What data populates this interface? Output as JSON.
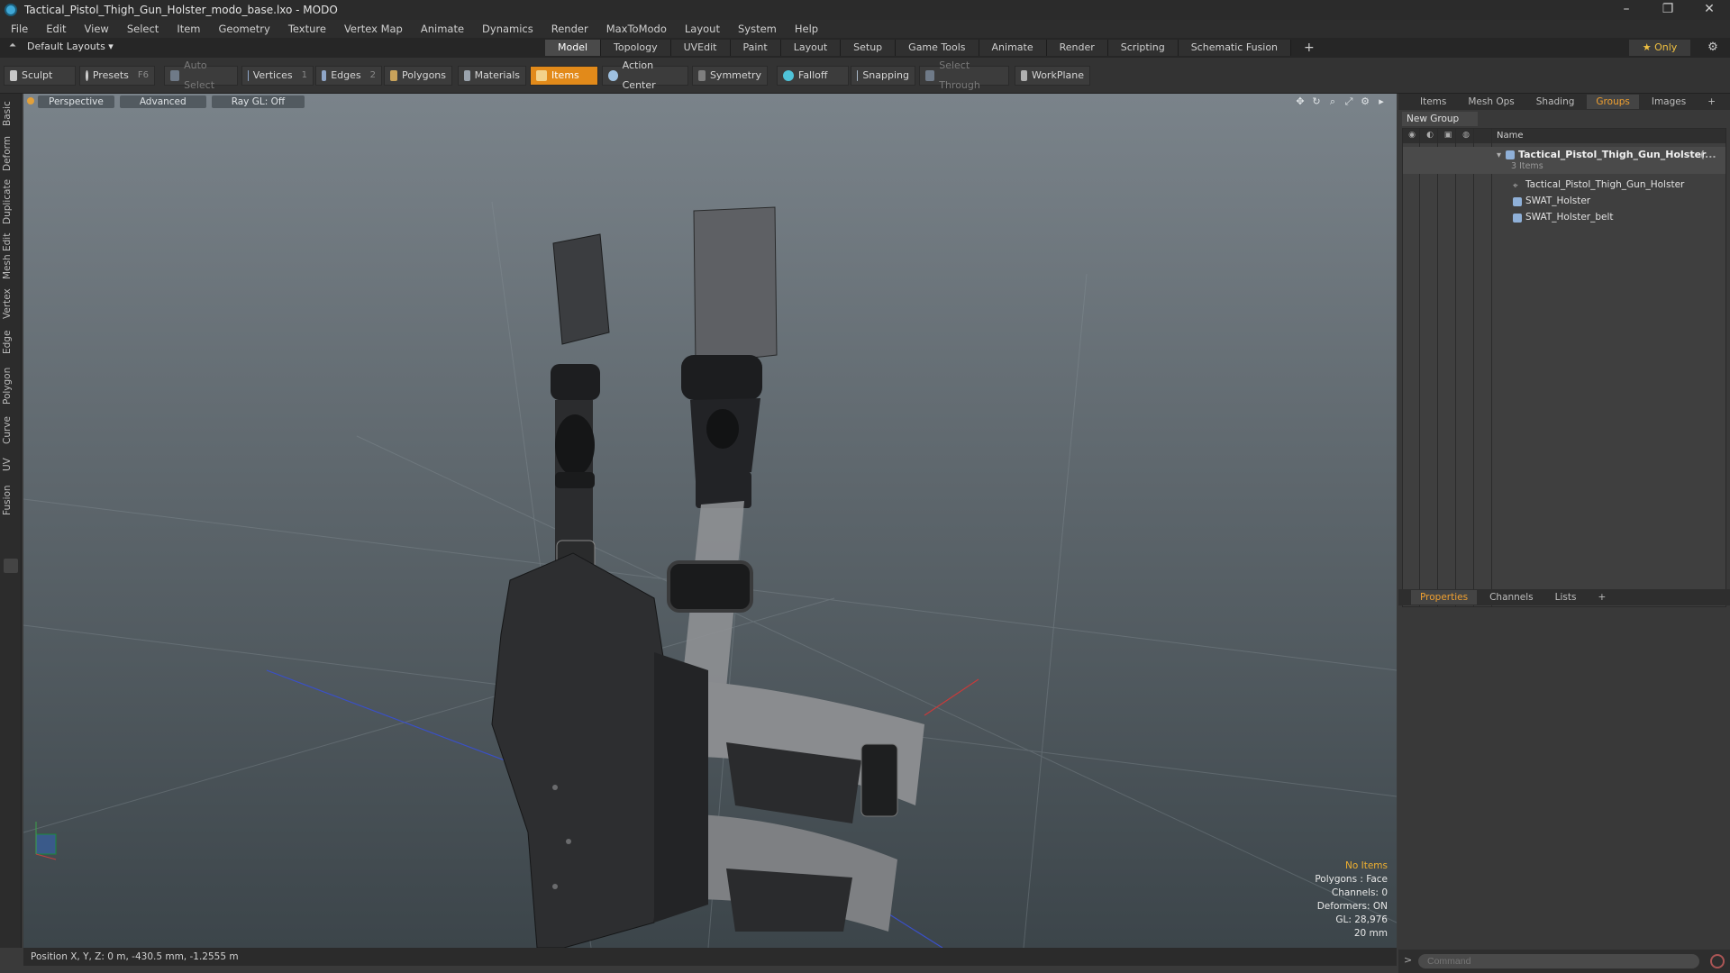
{
  "window": {
    "title": "Tactical_Pistol_Thigh_Gun_Holster_modo_base.lxo - MODO",
    "controls": [
      "–",
      "❐",
      "✕"
    ]
  },
  "menu": [
    "File",
    "Edit",
    "View",
    "Select",
    "Item",
    "Geometry",
    "Texture",
    "Vertex Map",
    "Animate",
    "Dynamics",
    "Render",
    "MaxToModo",
    "Layout",
    "System",
    "Help"
  ],
  "layout": {
    "current": "Default Layouts ▾",
    "tabs": [
      "Model",
      "Topology",
      "UVEdit",
      "Paint",
      "Layout",
      "Setup",
      "Game Tools",
      "Animate",
      "Render",
      "Scripting",
      "Schematic Fusion",
      "+"
    ],
    "active_tab": "Model",
    "only_label": "★  Only"
  },
  "toolbar": {
    "sculpt": "Sculpt",
    "presets": "Presets",
    "presets_key": "F6",
    "auto_select": "Auto Select",
    "vertices": "Vertices",
    "vertices_count": "1",
    "edges": "Edges",
    "edges_count": "2",
    "polygons": "Polygons",
    "materials": "Materials",
    "items": "Items",
    "action_center": "Action Center",
    "symmetry": "Symmetry",
    "falloff": "Falloff",
    "snapping": "Snapping",
    "select_through": "Select Through",
    "workplane": "WorkPlane"
  },
  "left_tabs": [
    "Basic",
    "Deform",
    "Duplicate",
    "Mesh Edit",
    "Vertex",
    "Edge",
    "Polygon",
    "Curve",
    "UV",
    "Fusion"
  ],
  "viewport": {
    "view_mode": "Perspective",
    "shading": "Advanced",
    "raygl": "Ray GL: Off",
    "hud": {
      "selection": "No Items",
      "polygons": "Polygons : Face",
      "channels": "Channels: 0",
      "deformers": "Deformers: ON",
      "gl": "GL: 28,976",
      "unit": "20 mm"
    }
  },
  "status": {
    "position": "Position X, Y, Z:  0 m, -430.5 mm, -1.2555 m"
  },
  "right_panel": {
    "tabs": [
      "Items",
      "Mesh Ops",
      "Shading",
      "Groups",
      "Images",
      "+"
    ],
    "active_tab": "Groups",
    "new_group": "New Group",
    "name_header": "Name",
    "group": {
      "name": "Tactical_Pistol_Thigh_Gun_Holster",
      "suffix": "(...",
      "count": "3 Items",
      "children": [
        "Tactical_Pistol_Thigh_Gun_Holster",
        "SWAT_Holster",
        "SWAT_Holster_belt"
      ]
    },
    "bottom_tabs": [
      "Properties",
      "Channels",
      "Lists",
      "+"
    ],
    "bottom_active": "Properties",
    "command_placeholder": "Command"
  },
  "colors": {
    "accent": "#e28a1a",
    "warning_text": "#f0b030"
  }
}
